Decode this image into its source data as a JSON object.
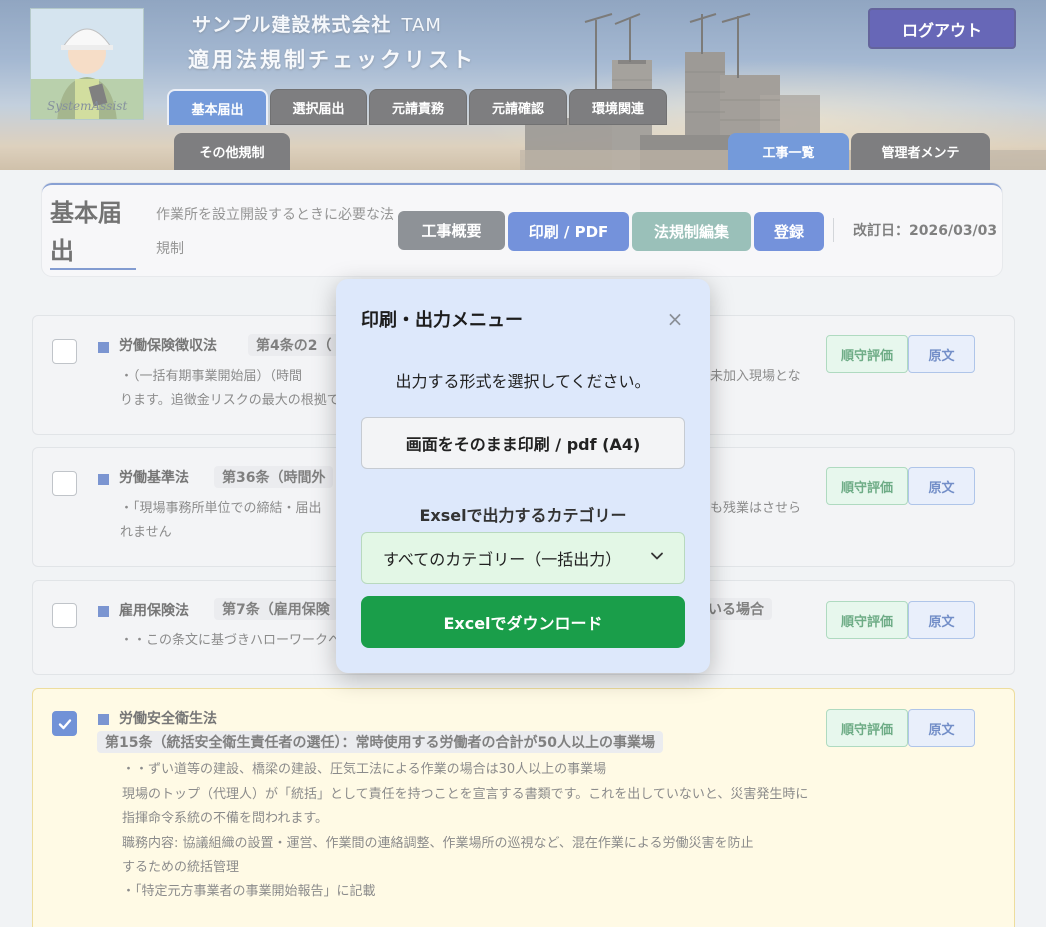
{
  "header": {
    "company": "サンプル建設株式会社",
    "company_suffix": "TAM",
    "app_title": "適用法規制チェックリスト",
    "avatar_signature": "SystemAssist",
    "logout_label": "ログアウト",
    "tabs": [
      "基本届出",
      "選択届出",
      "元請責務",
      "元請確認",
      "環境関連",
      "その他規制"
    ],
    "active_tab": "基本届出",
    "right_tabs": [
      "工事一覧",
      "管理者メンテ"
    ]
  },
  "page": {
    "title": "基本届出",
    "description": "作業所を設立開設するときに必要な法規制",
    "buttons": {
      "overview": "工事概要",
      "print": "印刷 / PDF",
      "edit": "法規制編集",
      "register": "登録"
    },
    "revision": "改訂日：2026/03/03"
  },
  "laws": [
    {
      "name": "労働保険徴収法",
      "article": "第4条の2（",
      "desc_lines": [
        "・（一括有期事業開始届）（時間",
        "ります。追徴金リスクの最大の根拠て"
      ],
      "desc_right": "未加入現場とな",
      "checked": false,
      "eval_label": "順守評価",
      "text_label": "原文"
    },
    {
      "name": "労働基準法",
      "article": "第36条（時間外",
      "desc_lines": [
        "・「現場事務所単位での締結・届出",
        "れません"
      ],
      "desc_right": "も残業はさせら",
      "checked": false,
      "eval_label": "順守評価",
      "text_label": "原文"
    },
    {
      "name": "雇用保険法",
      "article": "第7条（雇用保険",
      "article_right": "いる場合",
      "desc_lines": [
        "・・この条文に基づきハローワークへの届"
      ],
      "checked": false,
      "eval_label": "順守評価",
      "text_label": "原文"
    },
    {
      "name": "労働安全衛生法",
      "article": "第15条（統括安全衛生責任者の選任）：常時使用する労働者の合計が50人以上の事業場",
      "desc_lines": [
        "・・ずい道等の建設、橋梁の建設、圧気工法による作業の場合は30人以上の事業場",
        "現場のトップ（代理人）が「統括」として責任を持つことを宣言する書類です。これを出していないと、災害発生時に",
        "指揮命令系統の不備を問われます。",
        "職務内容: 協議組織の設置・運営、作業間の連絡調整、作業場所の巡視など、混在作業による労働災害を防止",
        "するための統括管理",
        "・「特定元方事業者の事業開始報告」に記載"
      ],
      "checked": true,
      "eval_label": "順守評価",
      "text_label": "原文"
    }
  ],
  "modal": {
    "title": "印刷・出力メニュー",
    "close_symbol": "×",
    "subtitle": "出力する形式を選択してください。",
    "print_button": "画面をそのまま印刷 / pdf (A4)",
    "excel_label": "Exselで出力するカテゴリー",
    "category_selected": "すべてのカテゴリー（一括出力）",
    "download_button": "Excelでダウンロード"
  },
  "colors": {
    "primary_blue": "#1f5dc4",
    "dark_tab": "#2f3033",
    "logout_navy": "#0a0a8c",
    "excel_green": "#1a9e4a",
    "edit_teal": "#5c9a8e"
  },
  "icons": [
    "close-icon",
    "chevron-down-icon",
    "checkmark-icon",
    "square-bullet-icon"
  ]
}
